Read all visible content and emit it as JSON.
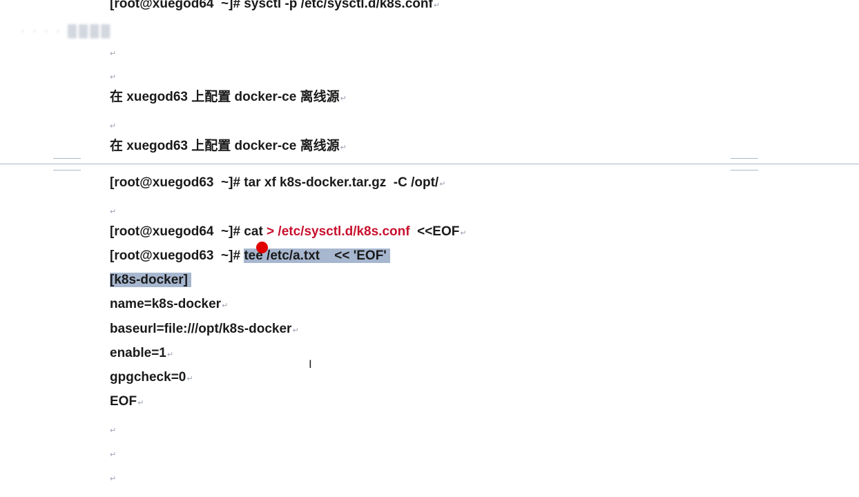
{
  "document": {
    "lines": [
      {
        "id": "l0",
        "text": "[root@xuegod64  ~]# sysctl -p /etc/sysctl.d/k8s.conf"
      },
      {
        "id": "l1",
        "text": ""
      },
      {
        "id": "l2",
        "text": ""
      },
      {
        "id": "l3",
        "text": "在 xuegod63 上配置 docker-ce 离线源"
      },
      {
        "id": "l4",
        "text": ""
      },
      {
        "id": "l5",
        "text": "在 xuegod63 上配置 docker-ce 离线源"
      },
      {
        "id": "l6",
        "text": "[root@xuegod63  ~]# tar xf k8s-docker.tar.gz  -C /opt/"
      },
      {
        "id": "l7",
        "text": ""
      },
      {
        "id": "l8",
        "prompt": "[root@xuegod64  ~]# cat ",
        "red": "> /etc/sysctl.d/k8s.conf",
        "tail": "  <<EOF"
      },
      {
        "id": "l9",
        "prompt": "[root@xuegod63  ~]# ",
        "selected": "tee /etc/a.txt    << 'EOF'"
      },
      {
        "id": "l10",
        "selected": "[k8s-docker]"
      },
      {
        "id": "l11",
        "text": "name=k8s-docker"
      },
      {
        "id": "l12",
        "text": "baseurl=file:///opt/k8s-docker"
      },
      {
        "id": "l13",
        "text": "enable=1"
      },
      {
        "id": "l14",
        "text": "gpgcheck=0"
      },
      {
        "id": "l15",
        "text": "EOF"
      },
      {
        "id": "l16",
        "text": ""
      },
      {
        "id": "l17",
        "text": ""
      },
      {
        "id": "l18",
        "text": ""
      }
    ],
    "paragraph_mark": "↵",
    "selection_end_mark": "·"
  },
  "colors": {
    "text": "#1a1a1a",
    "highlight_red": "#c8102e",
    "selection": "#a7b7cf",
    "page_break_line": "#a9b8c9",
    "record_dot": "#e00000"
  }
}
